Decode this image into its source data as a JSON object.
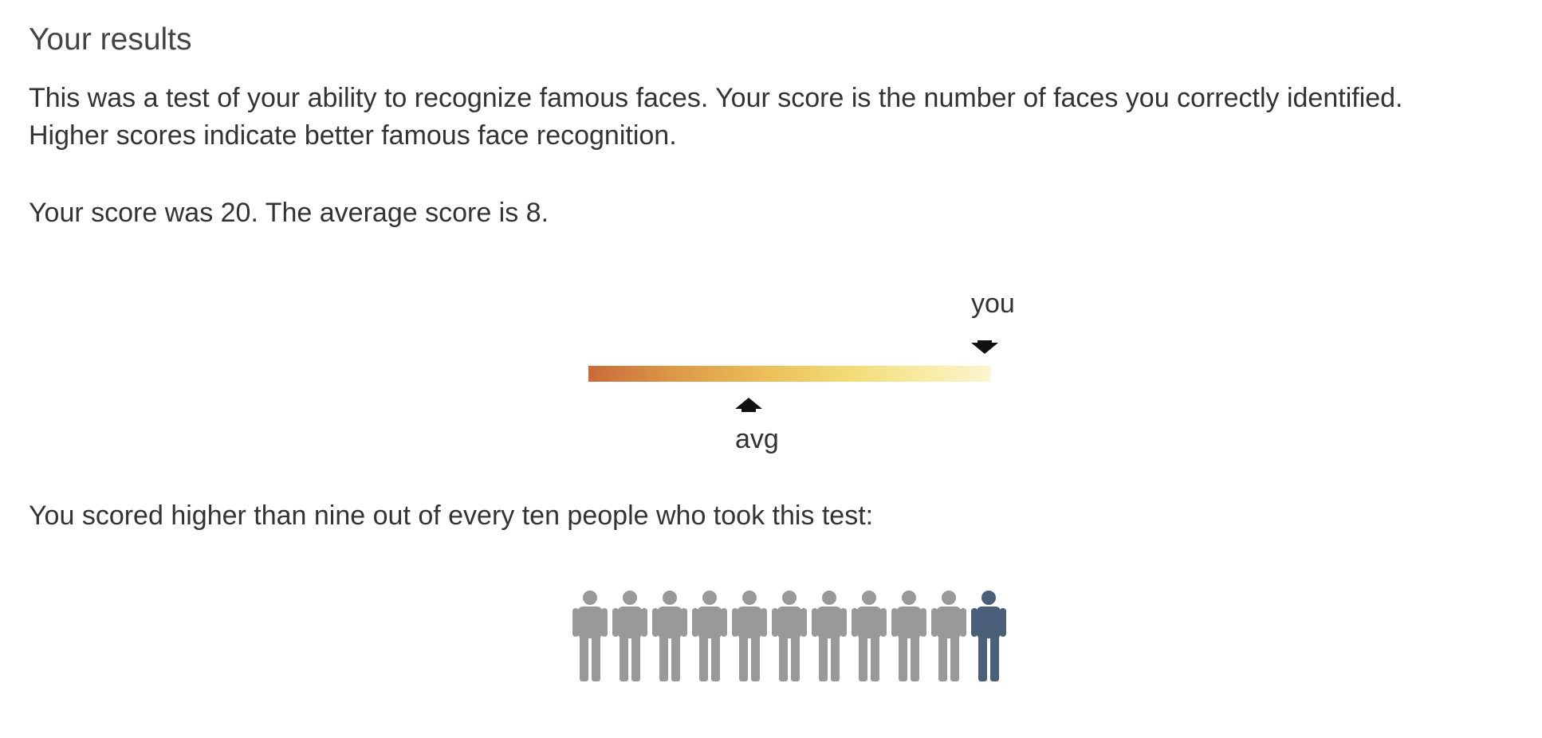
{
  "results": {
    "title": "Your results",
    "description_line1": "This was a test of your ability to recognize famous faces. Your score is the number of faces you correctly identified.",
    "description_line2": "Higher scores indicate better famous face recognition.",
    "score_text": "Your score was 20. The average score is 8.",
    "comparison_text": "You scored higher than nine out of every ten people who took this test:"
  },
  "scale": {
    "you_label": "you",
    "avg_label": "avg",
    "you_score": 20,
    "average_score": 8,
    "gradient_colors": [
      "#c96a3a",
      "#dd9a48",
      "#ebc05a",
      "#f2dc78",
      "#f8eca8",
      "#fbf4d0"
    ]
  },
  "people": {
    "total": 11,
    "highlighted_index": 10,
    "highlight_color": "#4a6078",
    "default_color": "#999999",
    "icon": "person-icon"
  }
}
